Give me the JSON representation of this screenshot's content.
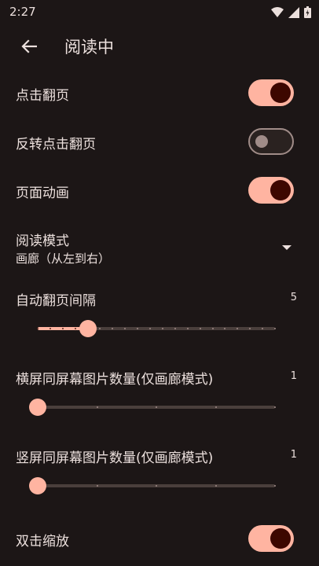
{
  "status_bar": {
    "time": "2:27"
  },
  "app_bar": {
    "title": "阅读中"
  },
  "settings": {
    "tap_to_turn": {
      "label": "点击翻页",
      "enabled": true
    },
    "reverse_tap": {
      "label": "反转点击翻页",
      "enabled": false
    },
    "page_animation": {
      "label": "页面动画",
      "enabled": true
    },
    "reading_mode": {
      "label": "阅读模式",
      "value": "画廊（从左到右）"
    },
    "auto_turn_interval": {
      "label": "自动翻页间隔",
      "value": "5",
      "min": 1,
      "max": 20,
      "current": 5
    },
    "landscape_images": {
      "label": "横屏同屏幕图片数量(仅画廊模式)",
      "value": "1",
      "min": 1,
      "max": 5,
      "current": 1
    },
    "portrait_images": {
      "label": "竖屏同屏幕图片数量(仅画廊模式)",
      "value": "1",
      "min": 1,
      "max": 5,
      "current": 1
    },
    "double_tap_zoom": {
      "label": "双击缩放",
      "enabled": true
    }
  },
  "colors": {
    "background": "#1c1616",
    "accent": "#ffb4a1",
    "thumb_on": "#3d0700",
    "text": "#ece0dd"
  }
}
